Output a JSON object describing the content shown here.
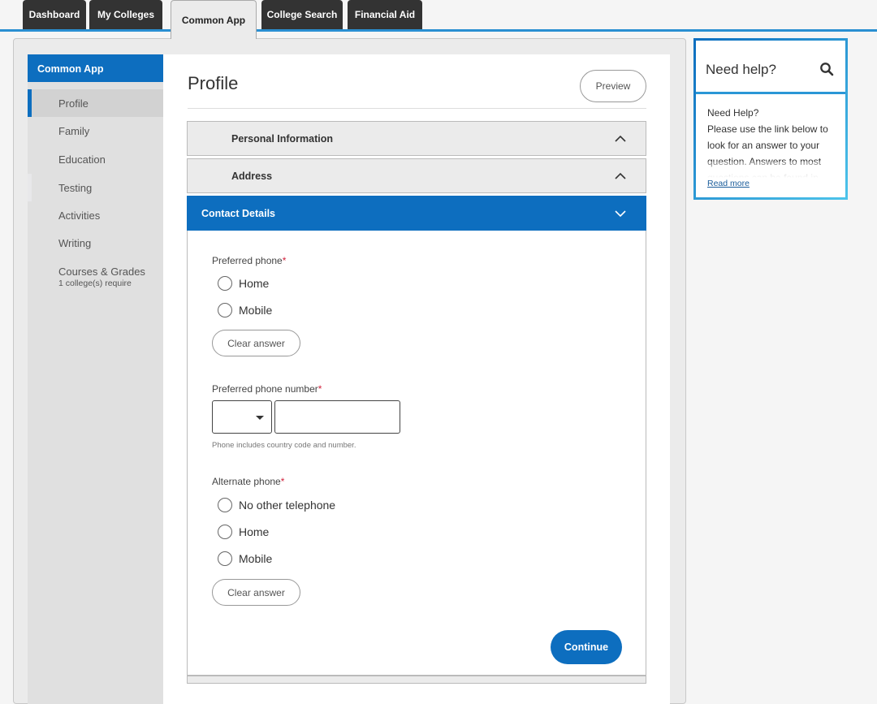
{
  "tabs": [
    {
      "label": "Dashboard",
      "active": false
    },
    {
      "label": "My Colleges",
      "active": false
    },
    {
      "label": "Common App",
      "active": true
    },
    {
      "label": "College Search",
      "active": false
    },
    {
      "label": "Financial Aid",
      "active": false
    }
  ],
  "sidebar": {
    "header": "Common App",
    "items": [
      {
        "label": "Profile",
        "active": true
      },
      {
        "label": "Family"
      },
      {
        "label": "Education"
      },
      {
        "label": "Testing"
      },
      {
        "label": "Activities"
      },
      {
        "label": "Writing"
      },
      {
        "label": "Courses & Grades",
        "sublabel": "1 college(s) require"
      }
    ]
  },
  "main": {
    "title": "Profile",
    "preview_label": "Preview",
    "sections": [
      {
        "label": "Personal Information",
        "state": "collapsed"
      },
      {
        "label": "Address",
        "state": "collapsed"
      },
      {
        "label": "Contact Details",
        "state": "expanded"
      }
    ],
    "form": {
      "preferred_phone": {
        "label": "Preferred phone",
        "required_mark": "*",
        "options": [
          "Home",
          "Mobile"
        ],
        "clear_label": "Clear answer"
      },
      "preferred_phone_number": {
        "label": "Preferred phone number",
        "required_mark": "*",
        "country_code_value": "",
        "number_value": "",
        "hint": "Phone includes country code and number."
      },
      "alternate_phone": {
        "label": "Alternate phone",
        "required_mark": "*",
        "options": [
          "No other telephone",
          "Home",
          "Mobile"
        ],
        "clear_label": "Clear answer"
      },
      "continue_label": "Continue"
    }
  },
  "help": {
    "title": "Need help?",
    "body_title": "Need Help?",
    "body_text": "Please use the link below to look for an answer to your question. Answers to most questions can be found in",
    "read_more": "Read more"
  },
  "colors": {
    "accent": "#0d6ebf",
    "tab_dark": "#333333",
    "required": "#d1213b"
  }
}
